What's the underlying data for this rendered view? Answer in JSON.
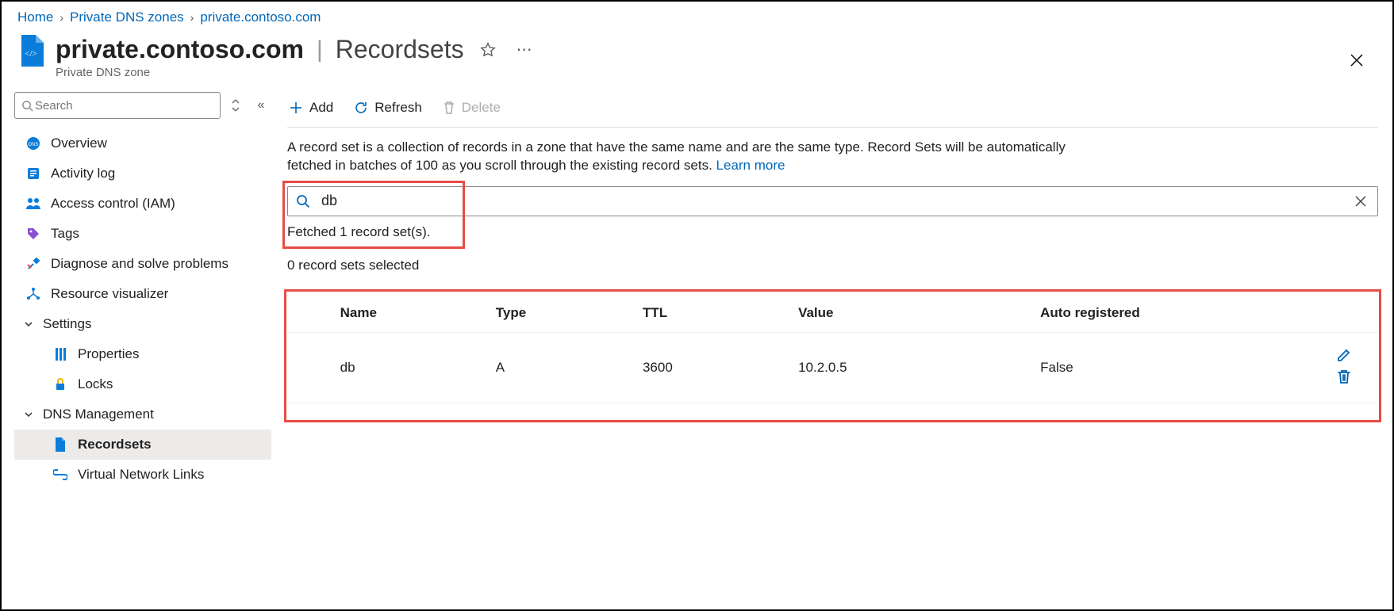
{
  "breadcrumb": {
    "items": [
      "Home",
      "Private DNS zones",
      "private.contoso.com"
    ]
  },
  "header": {
    "title": "private.contoso.com",
    "section": "Recordsets",
    "subtitle": "Private DNS zone"
  },
  "sidebar": {
    "search_placeholder": "Search",
    "items": {
      "overview": "Overview",
      "activity": "Activity log",
      "iam": "Access control (IAM)",
      "tags": "Tags",
      "diagnose": "Diagnose and solve problems",
      "visualizer": "Resource visualizer"
    },
    "settings": {
      "label": "Settings",
      "properties": "Properties",
      "locks": "Locks"
    },
    "dns": {
      "label": "DNS Management",
      "recordsets": "Recordsets",
      "vnet": "Virtual Network Links"
    }
  },
  "toolbar": {
    "add": "Add",
    "refresh": "Refresh",
    "delete": "Delete"
  },
  "description": {
    "text": "A record set is a collection of records in a zone that have the same name and are the same type. Record Sets will be automatically fetched in batches of 100 as you scroll through the existing record sets. ",
    "learn_more": "Learn more"
  },
  "search": {
    "value": "db"
  },
  "status": {
    "fetched": "Fetched 1 record set(s).",
    "selected": "0 record sets selected"
  },
  "table": {
    "columns": {
      "name": "Name",
      "type": "Type",
      "ttl": "TTL",
      "value": "Value",
      "auto": "Auto registered"
    },
    "rows": [
      {
        "name": "db",
        "type": "A",
        "ttl": "3600",
        "value": "10.2.0.5",
        "auto": "False"
      }
    ]
  }
}
